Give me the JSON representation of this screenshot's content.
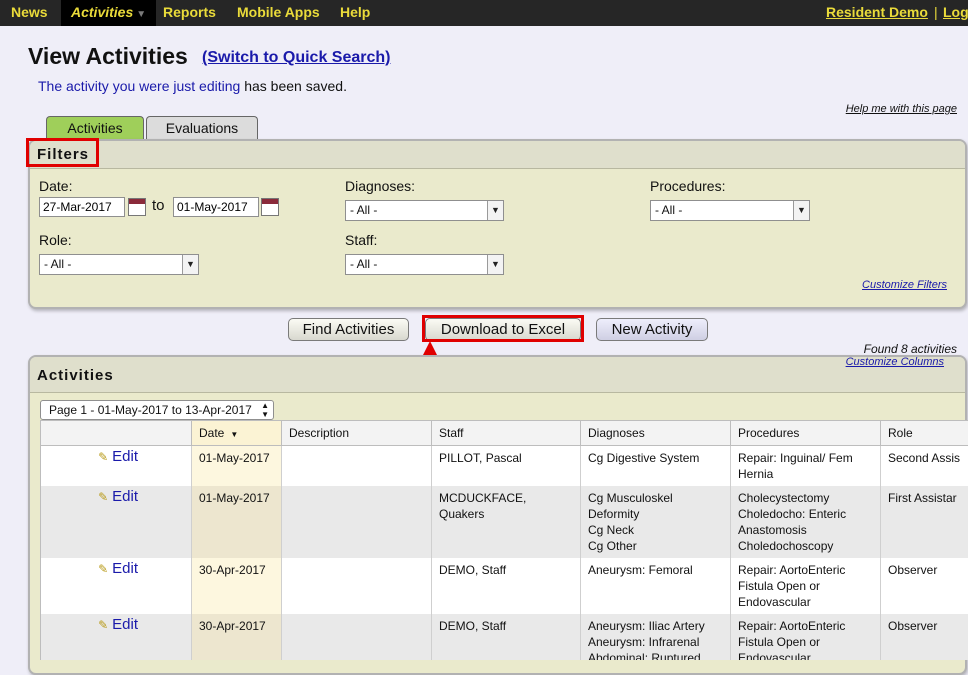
{
  "nav": {
    "items": [
      {
        "label": "News"
      },
      {
        "label": "Activities",
        "caret": "▼"
      },
      {
        "label": "Reports"
      },
      {
        "label": "Mobile Apps"
      },
      {
        "label": "Help"
      }
    ],
    "user_link": "Resident Demo",
    "separator": "|",
    "logout_link": "Log"
  },
  "header": {
    "title": "View Activities",
    "switch_link": "(Switch to Quick Search)",
    "saved_message_link": "The activity you were just editing",
    "saved_message_rest": " has been saved.",
    "help_link": "Help me with this page"
  },
  "tabs": [
    {
      "label": "Activities",
      "active": true
    },
    {
      "label": "Evaluations",
      "active": false
    }
  ],
  "filters": {
    "title": "Filters",
    "date_label": "Date:",
    "date_from": "27-Mar-2017",
    "to_label": "to",
    "date_to": "01-May-2017",
    "role_label": "Role:",
    "role_value": "- All -",
    "diagnoses_label": "Diagnoses:",
    "diagnoses_value": "- All -",
    "staff_label": "Staff:",
    "staff_value": "- All -",
    "procedures_label": "Procedures:",
    "procedures_value": "- All -",
    "customize_link": "Customize Filters"
  },
  "actions": {
    "find": "Find Activities",
    "download": "Download to Excel",
    "new": "New Activity"
  },
  "results": {
    "found_text": "Found 8 activities",
    "customize_columns": "Customize Columns",
    "panel_title": "Activities",
    "page_select": "Page 1 - 01-May-2017 to 13-Apr-2017",
    "columns": [
      "",
      "Date",
      "Description",
      "Staff",
      "Diagnoses",
      "Procedures",
      "Role"
    ],
    "sort_indicator": "▼",
    "rows": [
      {
        "edit": "Edit",
        "date": "01-May-2017",
        "description": "",
        "staff": [
          "PILLOT, Pascal"
        ],
        "diagnoses": [
          "Cg Digestive System"
        ],
        "procedures": [
          "Repair: Inguinal/ Fem",
          "Hernia"
        ],
        "role": "Second Assis"
      },
      {
        "edit": "Edit",
        "date": "01-May-2017",
        "description": "",
        "staff": [
          "MCDUCKFACE,",
          "Quakers"
        ],
        "diagnoses": [
          "Cg Musculoskel",
          "Deformity",
          "Cg Neck",
          "Cg Other"
        ],
        "procedures": [
          "Cholecystectomy",
          "Choledocho: Enteric",
          "Anastomosis",
          "Choledochoscopy"
        ],
        "role": "First Assistar"
      },
      {
        "edit": "Edit",
        "date": "30-Apr-2017",
        "description": "",
        "staff": [
          "DEMO, Staff"
        ],
        "diagnoses": [
          "Aneurysm: Femoral"
        ],
        "procedures": [
          "Repair: AortoEnteric",
          "Fistula Open or",
          "Endovascular"
        ],
        "role": "Observer"
      },
      {
        "edit": "Edit",
        "date": "30-Apr-2017",
        "description": "",
        "staff": [
          "DEMO, Staff"
        ],
        "diagnoses": [
          "Aneurysm: Iliac Artery",
          "Aneurysm: Infrarenal",
          "Abdominal: Ruptured"
        ],
        "procedures": [
          "Repair: AortoEnteric",
          "Fistula Open or",
          "Endovascular"
        ],
        "role": "Observer"
      }
    ]
  },
  "colors": {
    "nav_bg": "#262626",
    "nav_text": "#eadb3a",
    "active_tab": "#9fcf5a",
    "panel_bg": "#eaeacc",
    "highlight_red": "#e00000",
    "link_blue": "#1a1aaa"
  },
  "icons": {
    "calendar": "calendar-icon",
    "edit": "pencil-icon",
    "dropdown": "chevron-down-icon",
    "annotation_arrow": "arrow-up-icon"
  }
}
